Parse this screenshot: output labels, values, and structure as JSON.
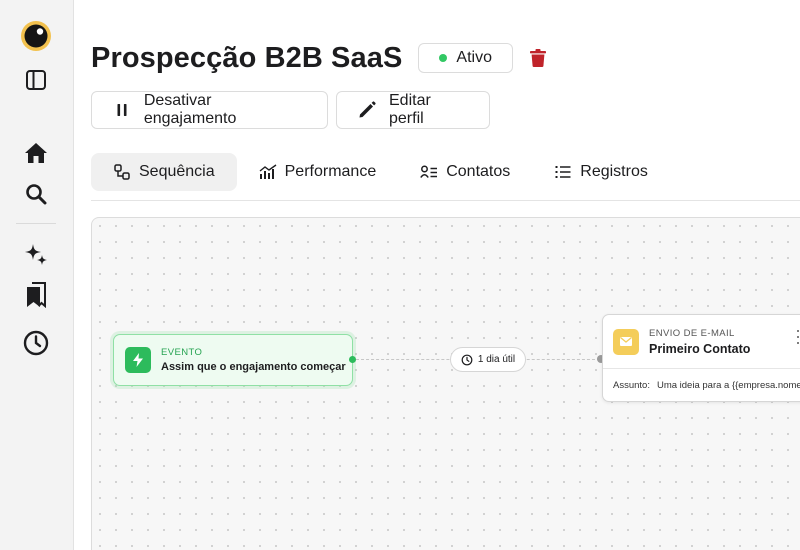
{
  "sidebar": {
    "items": [
      {
        "name": "logo",
        "icon": "eye-logo-icon"
      },
      {
        "name": "toggle-sidebar",
        "icon": "sidebar-panel-icon"
      },
      {
        "name": "home",
        "icon": "home-icon"
      },
      {
        "name": "search",
        "icon": "search-icon"
      },
      {
        "name": "ai",
        "icon": "sparkles-icon"
      },
      {
        "name": "bookmarks",
        "icon": "bookmarks-icon"
      },
      {
        "name": "history",
        "icon": "clock-icon"
      }
    ]
  },
  "header": {
    "title": "Prospecção B2B SaaS",
    "status": "Ativo",
    "status_color": "#32c864",
    "delete_color": "#c0232a"
  },
  "actions": {
    "deactivate_label": "Desativar engajamento",
    "edit_label": "Editar perfil"
  },
  "tabs": [
    {
      "label": "Sequência",
      "icon": "sequence-icon",
      "active": true
    },
    {
      "label": "Performance",
      "icon": "chart-icon",
      "active": false
    },
    {
      "label": "Contatos",
      "icon": "contacts-icon",
      "active": false
    },
    {
      "label": "Registros",
      "icon": "list-icon",
      "active": false
    }
  ],
  "flow": {
    "event_node": {
      "kicker": "EVENTO",
      "title": "Assim que o engajamento começar",
      "icon": "lightning-icon",
      "color": "#2dbb5c"
    },
    "delay": {
      "label": "1 dia útil",
      "icon": "clock-icon"
    },
    "email_node": {
      "kicker": "ENVIO DE E-MAIL",
      "title": "Primeiro Contato",
      "icon": "mail-icon",
      "color": "#f4cd5a",
      "subject_label": "Assunto:",
      "subject_value": "Uma ideia para a {{empresa.nome"
    }
  }
}
